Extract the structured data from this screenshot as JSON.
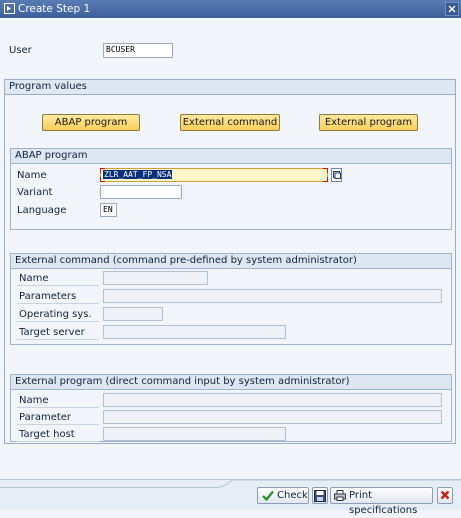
{
  "window": {
    "title": "Create Step  1"
  },
  "user": {
    "label": "User",
    "value": "BCUSER"
  },
  "program_values": {
    "title": "Program values",
    "buttons": {
      "abap": "ABAP program",
      "external_command": "External command",
      "external_program": "External program"
    }
  },
  "abap_program": {
    "title": "ABAP program",
    "name_label": "Name",
    "name_value": "ZLR_AAT_FP_NSA",
    "variant_label": "Variant",
    "variant_value": "",
    "language_label": "Language",
    "language_value": "EN"
  },
  "external_command": {
    "title": "External command (command pre-defined by system administrator)",
    "name_label": "Name",
    "parameters_label": "Parameters",
    "os_label": "Operating sys.",
    "server_label": "Target server"
  },
  "external_program": {
    "title": "External program (direct command input by system administrator)",
    "name_label": "Name",
    "parameter_label": "Parameter",
    "host_label": "Target host"
  },
  "toolbar": {
    "check_label": "Check",
    "print_label": "Print specifications"
  },
  "colors": {
    "accent": "#3d5f9a",
    "button_yellow": "#f9cf5a",
    "check_green": "#2d8a1f",
    "cancel_red": "#d01818"
  }
}
